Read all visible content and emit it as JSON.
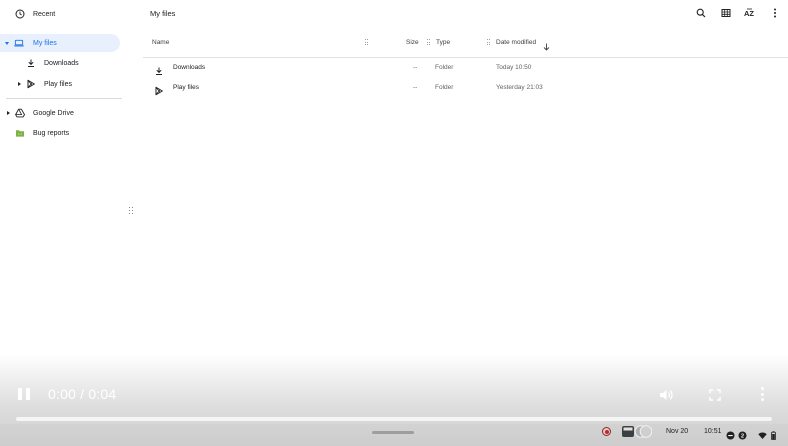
{
  "sidebar": {
    "recent": "Recent",
    "my_files": "My files",
    "downloads": "Downloads",
    "play_files": "Play files",
    "google_drive": "Google Drive",
    "bug_reports": "Bug reports"
  },
  "header": {
    "breadcrumb": "My files",
    "icons": [
      "search-icon",
      "grid-view-icon",
      "sort-az-icon",
      "more-vert-icon"
    ]
  },
  "file_list": {
    "columns": {
      "name": "Name",
      "size": "Size",
      "type": "Type",
      "date": "Date modified"
    },
    "sort": "descending",
    "rows": [
      {
        "name": "Downloads",
        "size": "--",
        "type": "Folder",
        "date": "Today 10:50",
        "icon": "download-icon"
      },
      {
        "name": "Play files",
        "size": "--",
        "type": "Folder",
        "date": "Yesterday 21:03",
        "icon": "play-store-icon"
      }
    ]
  },
  "video": {
    "time": "0:00 / 0:04",
    "progress": 0.0
  },
  "shelf": {
    "date": "Nov 20",
    "time": "10:51"
  },
  "colors": {
    "accent": "#1a73e8",
    "selected_bg": "#e8f0fe",
    "bug_reports_icon": "#7cb342",
    "record": "#c62828"
  }
}
